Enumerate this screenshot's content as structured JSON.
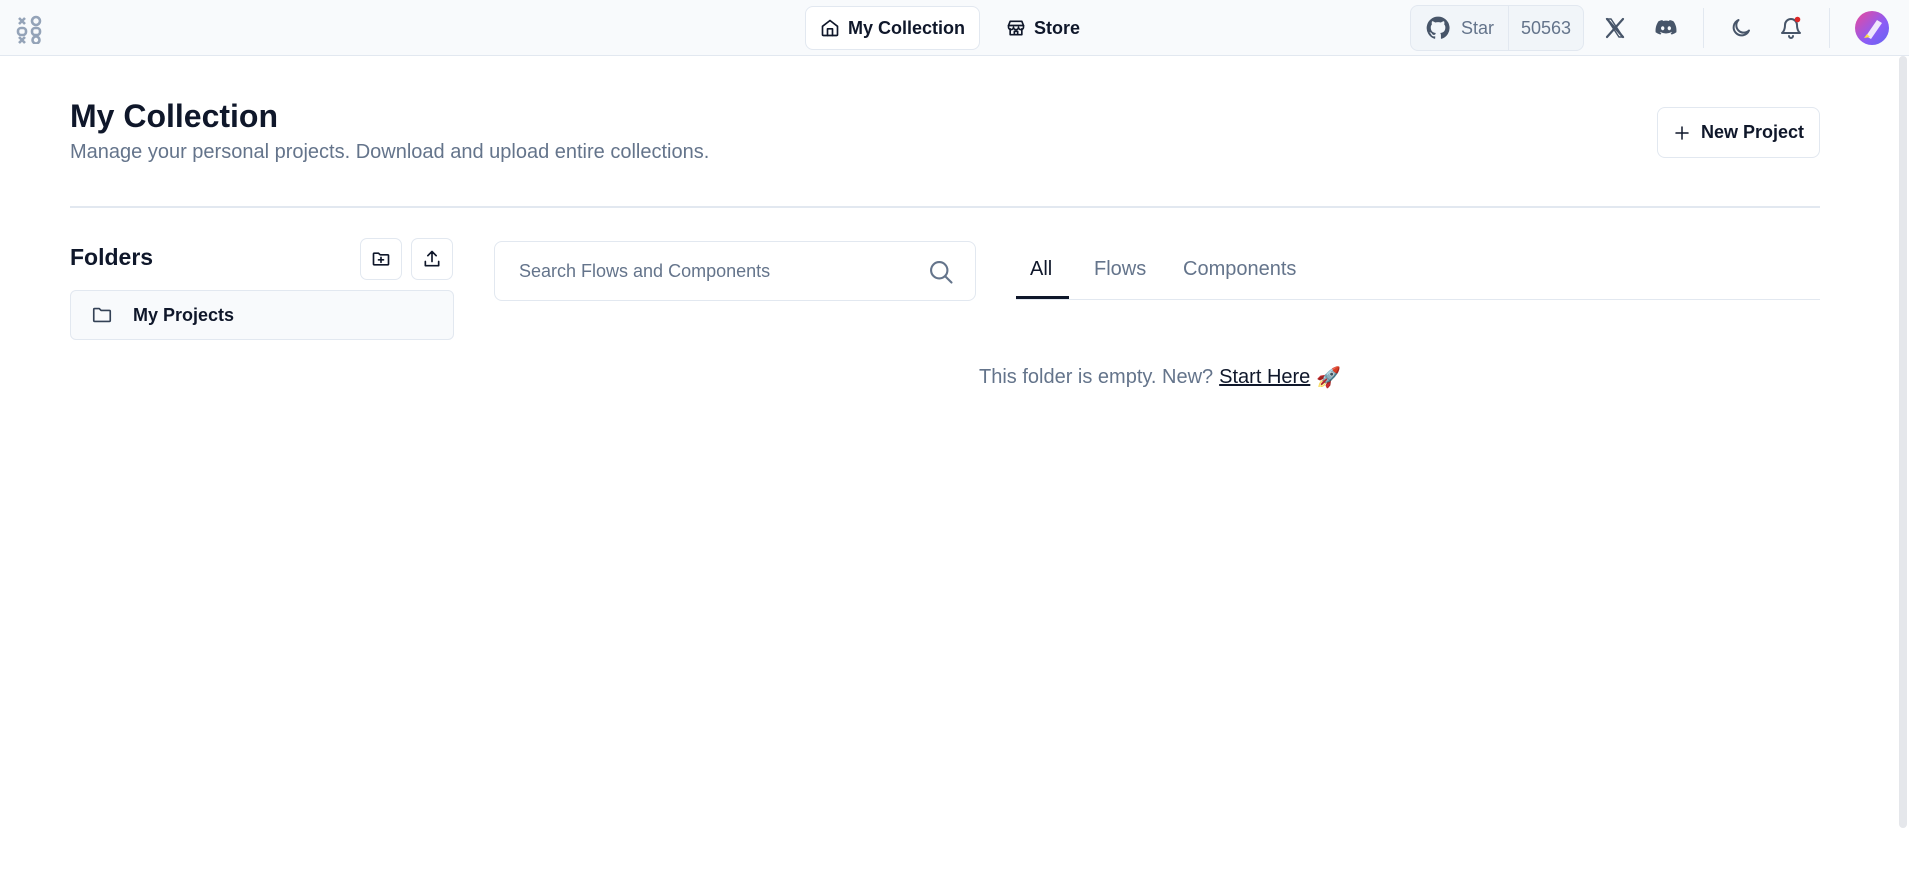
{
  "nav": {
    "my_collection": "My Collection",
    "store": "Store"
  },
  "github": {
    "star_label": "Star",
    "star_count": "50563"
  },
  "header": {
    "title": "My Collection",
    "subtitle": "Manage your personal projects. Download and upload entire collections.",
    "new_project_label": "New Project"
  },
  "folders": {
    "title": "Folders",
    "items": [
      {
        "label": "My Projects"
      }
    ]
  },
  "search": {
    "placeholder": "Search Flows and Components"
  },
  "tabs": [
    {
      "label": "All",
      "active": true
    },
    {
      "label": "Flows",
      "active": false
    },
    {
      "label": "Components",
      "active": false
    }
  ],
  "empty_state": {
    "text": "This folder is empty. New?",
    "link": "Start Here",
    "emoji": "🚀"
  },
  "icons": {
    "home": "home-icon",
    "store": "store-icon",
    "github": "github-icon",
    "x": "x-icon",
    "discord": "discord-icon",
    "theme": "moon-icon",
    "notifications": "bell-icon",
    "new_project": "plus-icon",
    "add_folder": "folder-plus-icon",
    "upload": "upload-icon",
    "folder": "folder-icon",
    "search": "search-icon"
  },
  "colors": {
    "notification_dot": "#dc2626",
    "text_primary": "#0f172a",
    "text_muted": "#64748b",
    "border": "#e2e8f0"
  }
}
